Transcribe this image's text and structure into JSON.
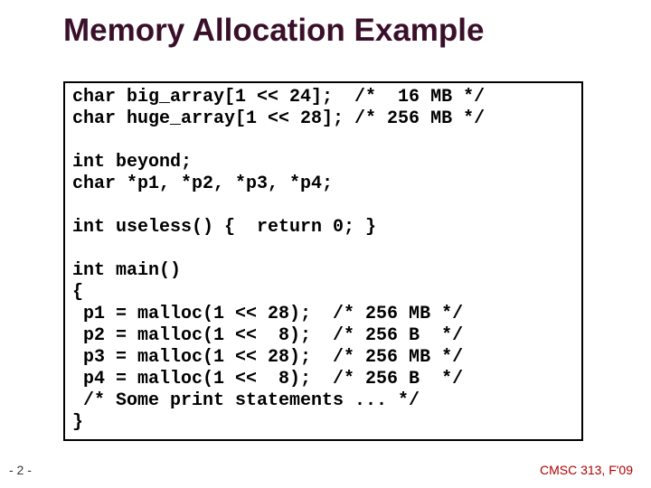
{
  "title": "Memory Allocation Example",
  "code": "char big_array[1 << 24];  /*  16 MB */\nchar huge_array[1 << 28]; /* 256 MB */\n\nint beyond;\nchar *p1, *p2, *p3, *p4;\n\nint useless() {  return 0; }\n\nint main()\n{\n p1 = malloc(1 << 28);  /* 256 MB */\n p2 = malloc(1 <<  8);  /* 256 B  */\n p3 = malloc(1 << 28);  /* 256 MB */\n p4 = malloc(1 <<  8);  /* 256 B  */\n /* Some print statements ... */\n}",
  "footer_left": "- 2 -",
  "footer_right": "CMSC 313, F'09"
}
